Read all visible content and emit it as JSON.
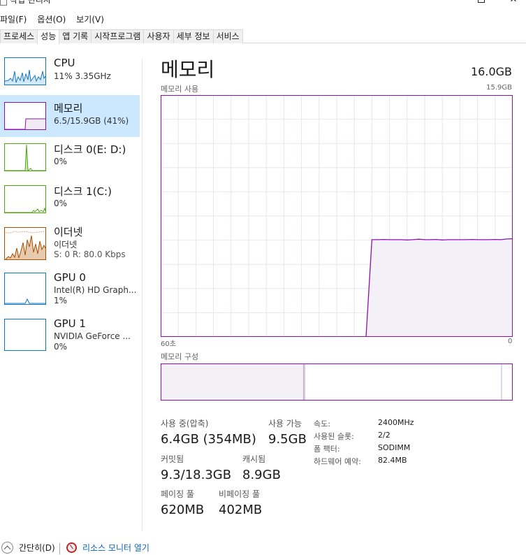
{
  "window": {
    "title": "작업 관리자",
    "minimize": "—",
    "close": "✕"
  },
  "menu": [
    "파일(F)",
    "옵션(O)",
    "보기(V)"
  ],
  "tabs": [
    {
      "label": "프로세스",
      "active": false
    },
    {
      "label": "성능",
      "active": true
    },
    {
      "label": "앱 기록",
      "active": false
    },
    {
      "label": "시작프로그램",
      "active": false
    },
    {
      "label": "사용자",
      "active": false
    },
    {
      "label": "세부 정보",
      "active": false
    },
    {
      "label": "서비스",
      "active": false
    }
  ],
  "sidebar": {
    "items": [
      {
        "name": "CPU",
        "sub1": "11% 3.35GHz",
        "sub2": "",
        "color": "#1175c4",
        "selected": false
      },
      {
        "name": "메모리",
        "sub1": "6.5/15.9GB (41%)",
        "sub2": "",
        "color": "#8b12ae",
        "selected": true
      },
      {
        "name": "디스크 0(E: D:)",
        "sub1": "0%",
        "sub2": "",
        "color": "#4da60c",
        "selected": false
      },
      {
        "name": "디스크 1(C:)",
        "sub1": "0%",
        "sub2": "",
        "color": "#4da60c",
        "selected": false
      },
      {
        "name": "이더넷",
        "sub1": "이더넷",
        "sub2": "S: 0 R: 80.0 Kbps",
        "color": "#a74f01",
        "selected": false
      },
      {
        "name": "GPU 0",
        "sub1": "Intel(R) HD Graph...",
        "sub2": "1%",
        "color": "#1175c4",
        "selected": false
      },
      {
        "name": "GPU 1",
        "sub1": "NVIDIA GeForce ...",
        "sub2": "0%",
        "color": "#1175c4",
        "selected": false
      }
    ]
  },
  "main": {
    "title": "메모리",
    "total": "16.0GB",
    "usage_label": "메모리 사용",
    "usage_max": "15.9GB",
    "axis_left": "60초",
    "axis_right": "0",
    "composition_label": "메모리 구성",
    "accent_color": "#8b12ae",
    "usage_series": [
      0,
      0,
      0,
      0,
      0,
      0,
      0,
      0,
      0,
      0,
      0,
      0,
      0,
      0,
      0,
      0,
      0,
      0,
      0,
      0,
      0,
      0,
      0,
      0,
      0,
      0,
      0,
      0,
      0,
      0,
      0,
      0,
      0,
      0,
      0,
      0,
      40.2,
      40.2,
      40.3,
      40.2,
      40.2,
      40.2,
      40.1,
      40.2,
      40.4,
      40.2,
      40.2,
      40.3,
      40.1,
      40.2,
      40.2,
      40.2,
      40.2,
      40.3,
      40.2,
      40.2,
      40.2,
      40.3,
      40.2,
      40.5,
      40.6
    ]
  },
  "stats": {
    "in_use_label": "사용 중(압축)",
    "in_use_value": "6.4GB (354MB)",
    "available_label": "사용 가능",
    "available_value": "9.5GB",
    "committed_label": "커밋됨",
    "committed_value": "9.3/18.3GB",
    "cached_label": "캐시됨",
    "cached_value": "8.9GB",
    "paged_label": "페이징 풀",
    "paged_value": "620MB",
    "nonpaged_label": "비페이징 풀",
    "nonpaged_value": "402MB"
  },
  "details": [
    {
      "key": "속도:",
      "value": "2400MHz"
    },
    {
      "key": "사용된 슬롯:",
      "value": "2/2"
    },
    {
      "key": "폼 팩터:",
      "value": "SODIMM"
    },
    {
      "key": "하드웨어 예약:",
      "value": "82.4MB"
    }
  ],
  "footer": {
    "fewer_details": "간단히(D)",
    "resource_monitor": "리소스 모니터 열기"
  }
}
